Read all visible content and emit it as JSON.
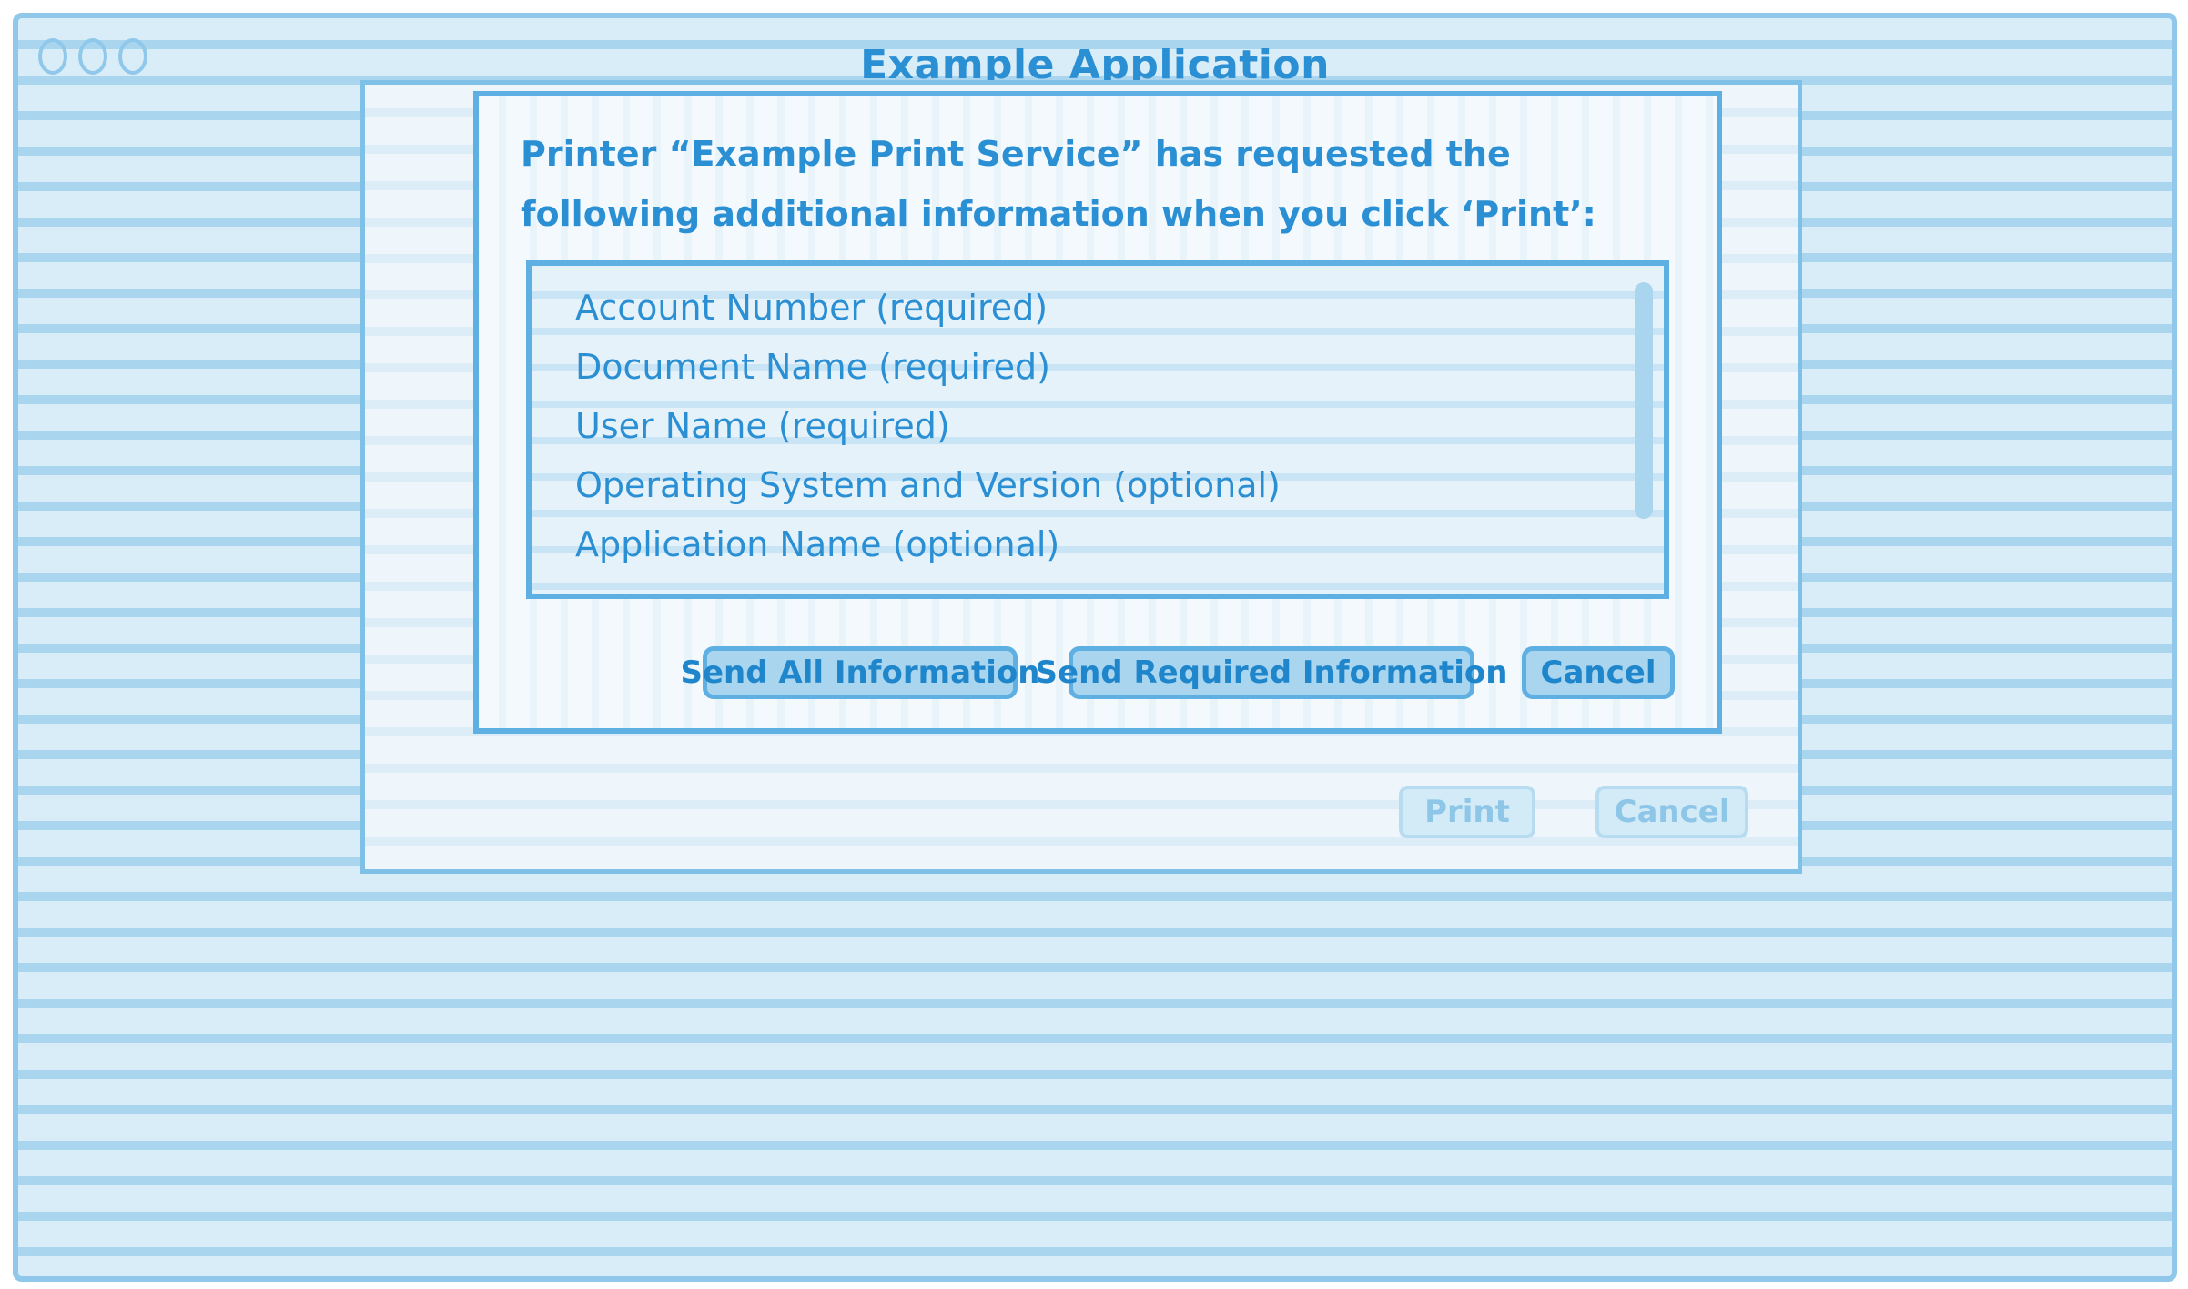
{
  "window": {
    "title": "Example Application"
  },
  "print_sheet": {
    "print_label": "Print",
    "cancel_label": "Cancel"
  },
  "dialog": {
    "message": "Printer “Example Print Service” has requested the following additional information when you click ‘Print’:",
    "items": [
      "Account Number (required)",
      "Document Name (required)",
      "User Name (required)",
      "Operating System and Version (optional)",
      "Application Name (optional)"
    ],
    "send_all_label": "Send All Information",
    "send_required_label": "Send  Required Information",
    "cancel_label": "Cancel"
  },
  "colors": {
    "accent": "#2b8fd4",
    "border": "#5fb0e2",
    "background": "#d9edf8"
  }
}
